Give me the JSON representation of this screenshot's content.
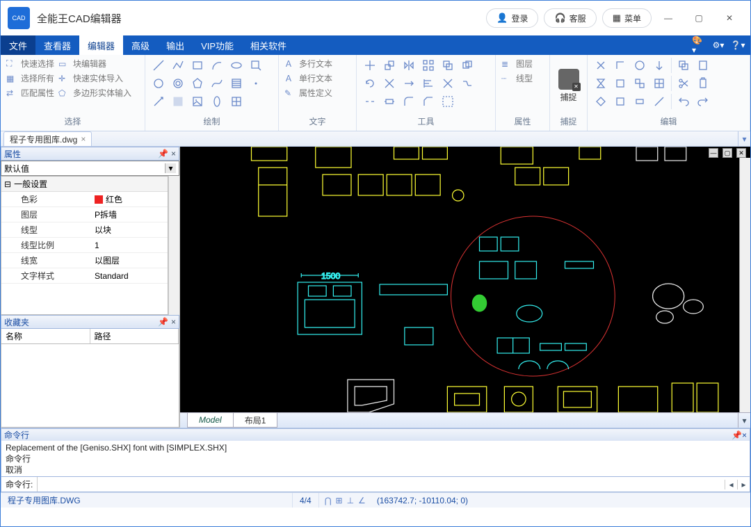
{
  "title": "全能王CAD编辑器",
  "titleButtons": {
    "login": "登录",
    "service": "客服",
    "menu": "菜单"
  },
  "menus": [
    "文件",
    "查看器",
    "编辑器",
    "高级",
    "输出",
    "VIP功能",
    "相关软件"
  ],
  "activeMenuIndex": 2,
  "ribbon": {
    "select": {
      "title": "选择",
      "items": [
        "快速选择",
        "块编辑器",
        "选择所有",
        "快速实体导入",
        "匹配属性",
        "多边形实体输入"
      ]
    },
    "draw": {
      "title": "绘制"
    },
    "text": {
      "title": "文字",
      "items": [
        "多行文本",
        "单行文本",
        "属性定义"
      ]
    },
    "tools": {
      "title": "工具"
    },
    "props": {
      "title": "属性",
      "items": [
        "图层",
        "线型"
      ]
    },
    "capture": {
      "title": "捕捉"
    },
    "edit": {
      "title": "编辑"
    }
  },
  "fileTab": "程子专用图库.dwg",
  "panels": {
    "props": {
      "title": "属性",
      "comboValue": "默认值",
      "category": "一般设置",
      "rows": [
        {
          "k": "色彩",
          "v": "红色",
          "color": true
        },
        {
          "k": "图层",
          "v": "P拆墙"
        },
        {
          "k": "线型",
          "v": "以块"
        },
        {
          "k": "线型比例",
          "v": "1"
        },
        {
          "k": "线宽",
          "v": "以图层"
        },
        {
          "k": "文字样式",
          "v": "Standard"
        }
      ]
    },
    "fav": {
      "title": "收藏夹",
      "cols": [
        "名称",
        "路径"
      ]
    }
  },
  "layoutTabs": [
    "Model",
    "布局1"
  ],
  "cmd": {
    "title": "命令行",
    "log": [
      "Replacement of the [Geniso.SHX] font with [SIMPLEX.SHX]",
      "命令行",
      "取消"
    ],
    "prompt": "命令行:"
  },
  "status": {
    "file": "程子专用图库.DWG",
    "count": "4/4",
    "coords": "(163742.7; -10110.04; 0)"
  },
  "canvas": {
    "dim": "1500"
  }
}
